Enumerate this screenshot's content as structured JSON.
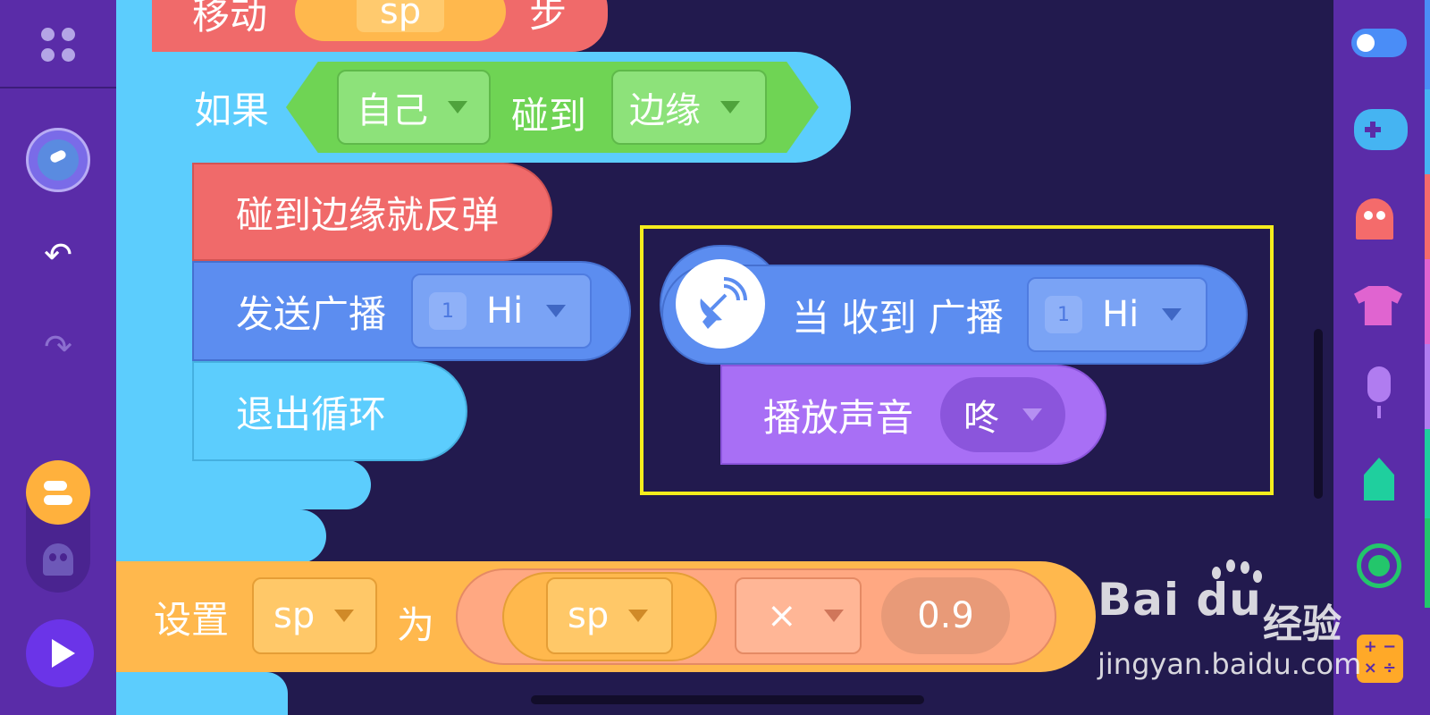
{
  "left_toolbar": {
    "icons": [
      "grid-icon",
      "avatar-icon",
      "undo-icon",
      "redo-icon",
      "block-category-icon",
      "ghost-icon",
      "play-icon"
    ],
    "undo_glyph": "↶",
    "redo_glyph": "↷"
  },
  "blocks": {
    "move": {
      "label": "移动",
      "var": "sp",
      "suffix": "步"
    },
    "if": {
      "label": "如果",
      "sprite": "自己",
      "touch_label": "碰到",
      "target": "边缘"
    },
    "bounce": {
      "label": "碰到边缘就反弹"
    },
    "broadcast": {
      "label": "发送广播",
      "num": "1",
      "message": "Hi"
    },
    "exit_loop": {
      "label": "退出循环"
    },
    "set": {
      "label": "设置",
      "var": "sp",
      "to_label": "为",
      "operand_var": "sp",
      "operator": "×",
      "value": "0.9"
    }
  },
  "event_script": {
    "hat": {
      "label": "当 收到 广播",
      "num": "1",
      "message": "Hi"
    },
    "play_sound": {
      "label": "播放声音",
      "sound": "咚"
    }
  },
  "right_palette": {
    "icons": [
      "toggle-icon",
      "gamepad-icon",
      "ghost-icon",
      "shirt-icon",
      "microphone-icon",
      "pen-icon",
      "circle-icon",
      "calculator-icon"
    ],
    "calc_glyphs": "+ −\n× ÷"
  },
  "watermark": {
    "brand": "Bai du",
    "product": "经验",
    "url": "jingyan.baidu.com"
  },
  "colors": {
    "canvas": "#221a4e",
    "toolbar": "#5a2ca8",
    "motion_red": "#f06a6a",
    "control_cyan": "#5ccdfd",
    "sensing_green": "#6fd454",
    "event_blue": "#5c8df0",
    "sound_purple": "#a86ff5",
    "variable_orange": "#ffb84d",
    "operator_salmon": "#ffa882",
    "selection_yellow": "#f5ec1d"
  }
}
